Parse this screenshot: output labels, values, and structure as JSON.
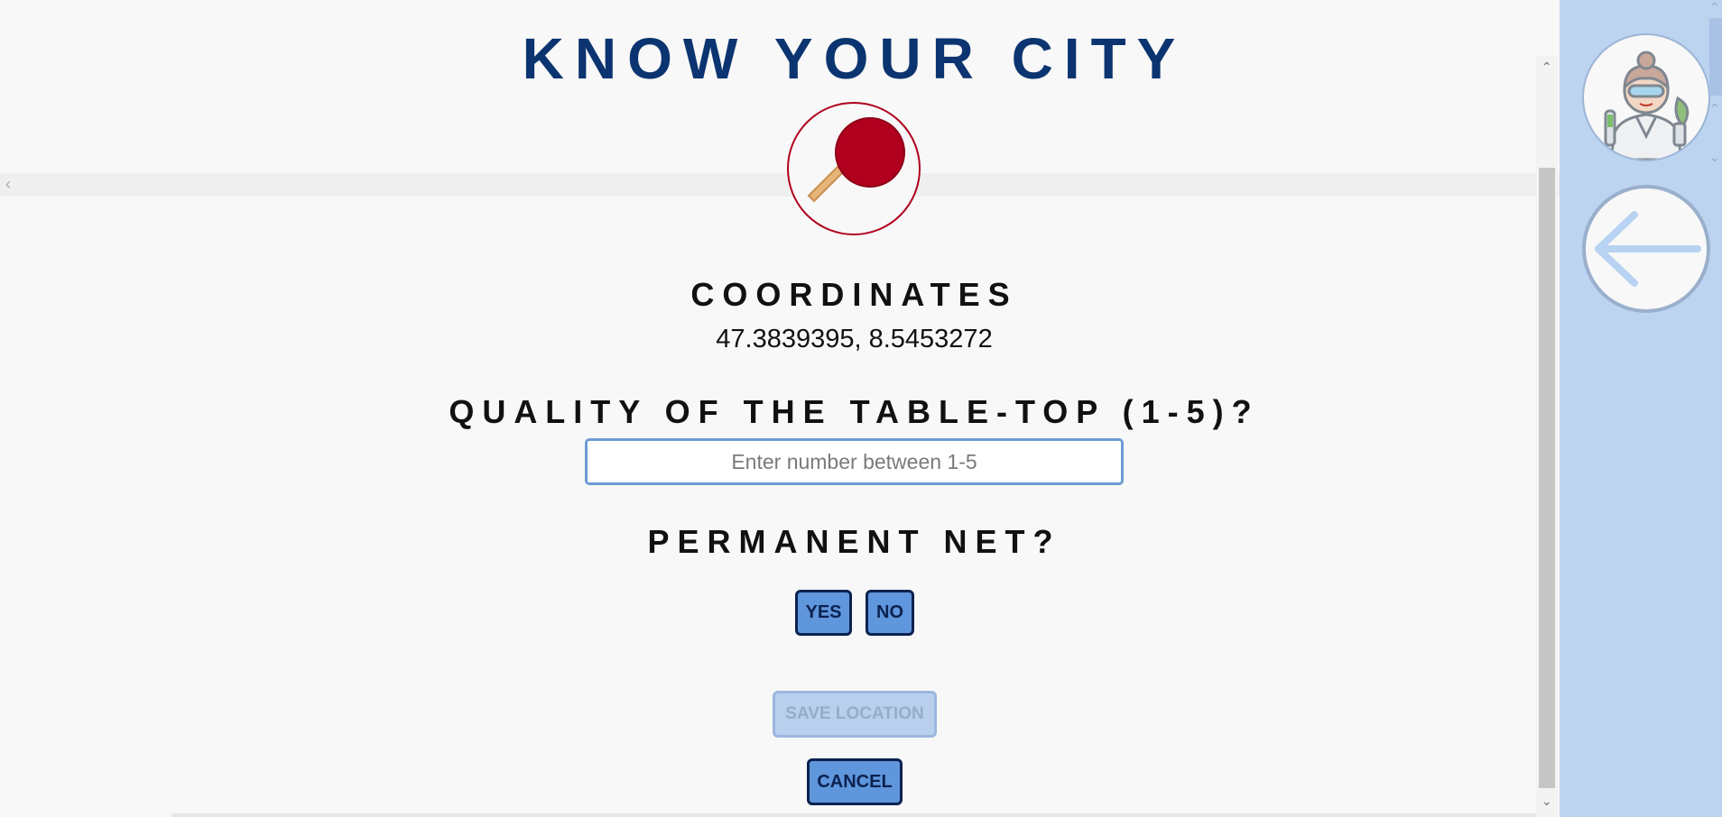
{
  "app": {
    "title": "KNOW YOUR CITY"
  },
  "location_icon": "ping-pong-paddle-icon",
  "coordinates": {
    "label": "COORDINATES",
    "value": "47.3839395, 8.5453272"
  },
  "quality": {
    "label": "QUALITY OF THE TABLE-TOP (1-5)?",
    "value": "",
    "placeholder": "Enter number between 1-5"
  },
  "permanent_net": {
    "label": "PERMANENT NET?",
    "yes_label": "YES",
    "no_label": "NO"
  },
  "actions": {
    "save_label": "SAVE LOCATION",
    "save_enabled": false,
    "cancel_label": "CANCEL"
  },
  "sidebar": {
    "avatar_icon": "scientist-avatar-icon",
    "back_icon": "arrow-left-icon"
  },
  "colors": {
    "title": "#0b3470",
    "accent": "#5f96dc",
    "paddle": "#b0001e",
    "sidebar_bg": "#bdd4f1"
  }
}
